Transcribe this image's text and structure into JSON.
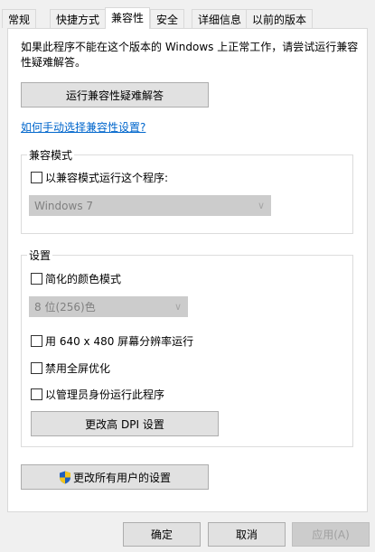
{
  "tabs": [
    "常规",
    "快捷方式",
    "兼容性",
    "安全",
    "详细信息",
    "以前的版本"
  ],
  "intro_text": "如果此程序不能在这个版本的 Windows 上正常工作，请尝试运行兼容性疑难解答。",
  "troubleshoot_button": "运行兼容性疑难解答",
  "manual_link": "如何手动选择兼容性设置?",
  "compat_mode": {
    "title": "兼容模式",
    "checkbox_label": "以兼容模式运行这个程序:",
    "selected_os": "Windows 7"
  },
  "settings": {
    "title": "设置",
    "reduced_color_label": "简化的颜色模式",
    "color_value": "8 位(256)色",
    "resolution_label": "用 640 x 480 屏幕分辨率运行",
    "disable_fullscreen_label": "禁用全屏优化",
    "run_as_admin_label": "以管理员身份运行此程序",
    "dpi_button": "更改高 DPI 设置"
  },
  "all_users_button": "更改所有用户的设置",
  "footer": {
    "ok": "确定",
    "cancel": "取消",
    "apply": "应用(A)"
  },
  "colors": {
    "link": "#0066cc",
    "button_face": "#e1e1e1",
    "disabled_face": "#cccccc",
    "window_bg": "#f0f0f0"
  },
  "icons": {
    "uac": "uac-shield-icon",
    "dropdown": "chevron-down-icon"
  }
}
